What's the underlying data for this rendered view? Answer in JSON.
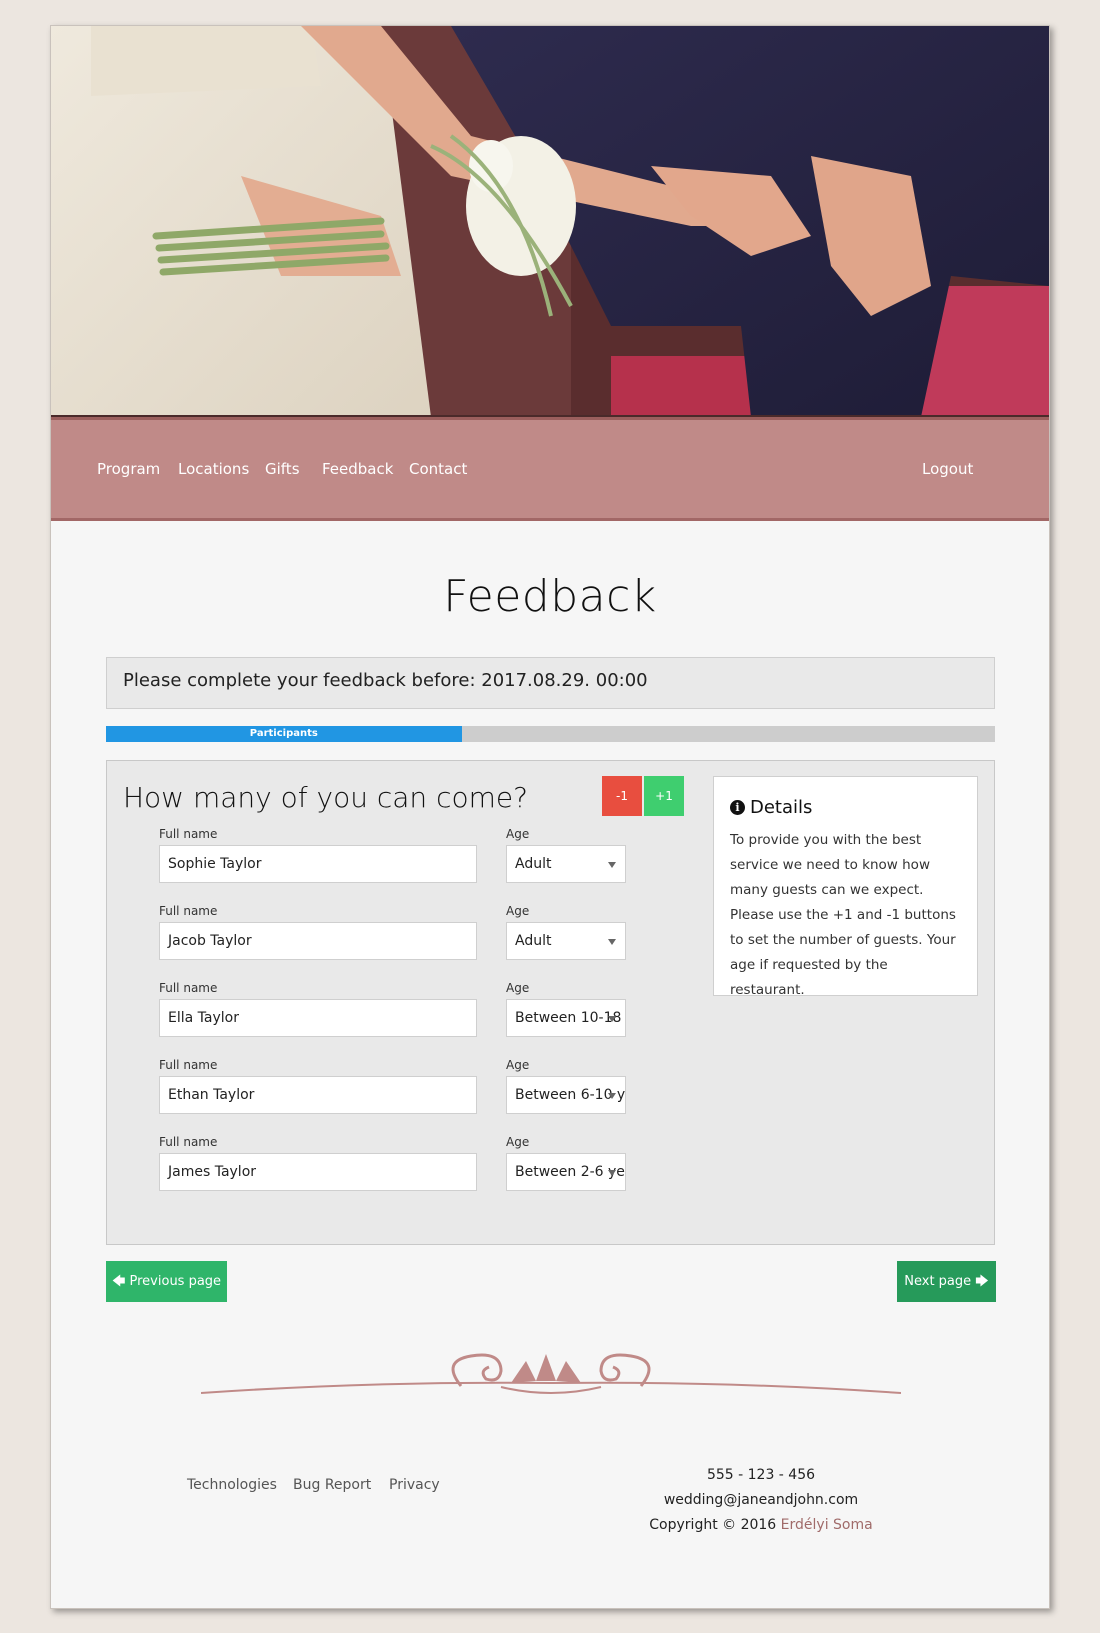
{
  "nav": {
    "items": [
      "Program",
      "Locations",
      "Gifts",
      "Feedback",
      "Contact"
    ],
    "logout": "Logout"
  },
  "page_title": "Feedback",
  "deadline_text": "Please complete your feedback before: 2017.08.29. 00:00",
  "progress": {
    "label": "Participants",
    "fraction": 0.4
  },
  "question": "How many of you can come?",
  "buttons": {
    "minus": "-1",
    "plus": "+1",
    "previous": "Previous page",
    "next": "Next page"
  },
  "participants": [
    {
      "name_label": "Full name",
      "name": "Sophie Taylor",
      "age_label": "Age",
      "age": "Adult"
    },
    {
      "name_label": "Full name",
      "name": "Jacob Taylor",
      "age_label": "Age",
      "age": "Adult"
    },
    {
      "name_label": "Full name",
      "name": "Ella Taylor",
      "age_label": "Age",
      "age": "Between 10-18"
    },
    {
      "name_label": "Full name",
      "name": "Ethan Taylor",
      "age_label": "Age",
      "age": "Between 6-10 y"
    },
    {
      "name_label": "Full name",
      "name": "James Taylor",
      "age_label": "Age",
      "age": "Between 2-6 ye"
    }
  ],
  "details": {
    "title": "Details",
    "text": "To provide you with the best service we need to know how many guests can we expect. Please use the +1 and -1 buttons to set the number of guests. Your age if requested by the restaurant."
  },
  "footer": {
    "links": [
      "Technologies",
      "Bug Report",
      "Privacy"
    ],
    "phone": "555 - 123 - 456",
    "email": "wedding@janeandjohn.com",
    "copyright": "Copyright © 2016",
    "author": "Erdélyi Soma"
  },
  "colors": {
    "nav": "#c08a88",
    "progress": "#2196e3",
    "minus": "#e84e3f",
    "plus": "#3fce6f",
    "green": "#2fb56a"
  }
}
